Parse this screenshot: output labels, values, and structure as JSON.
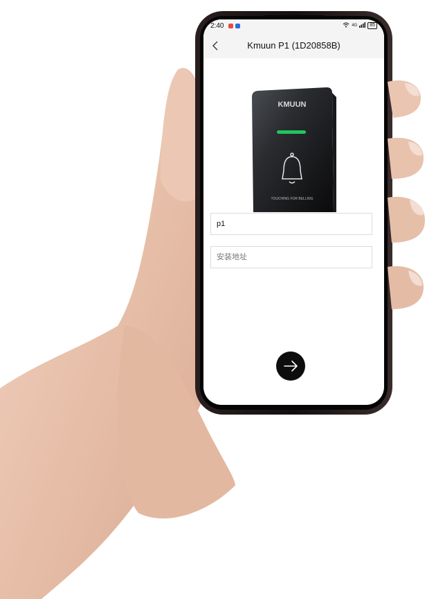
{
  "status_bar": {
    "time": "2:40",
    "battery": "85",
    "signal": "4G"
  },
  "header": {
    "title": "Kmuun P1 (1D20858B)",
    "back_icon": "chevron-left-icon"
  },
  "device": {
    "brand": "KMUUN",
    "caption": "TOUCHING FOR BELLING",
    "indicator_color": "#22c55e"
  },
  "form": {
    "name_value": "p1",
    "address_placeholder": "安装地址"
  },
  "actions": {
    "next_icon": "arrow-right-icon"
  },
  "colors": {
    "skin": "#e9c4b0",
    "phone_frame": "#1a1414",
    "button": "#0d0d0d"
  }
}
